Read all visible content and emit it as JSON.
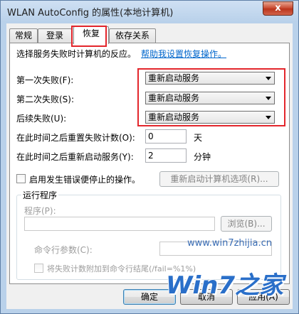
{
  "window": {
    "title": "WLAN AutoConfig 的属性(本地计算机)",
    "close_label": "x"
  },
  "tabs": [
    {
      "label": "常规"
    },
    {
      "label": "登录"
    },
    {
      "label": "恢复"
    },
    {
      "label": "依存关系"
    }
  ],
  "recovery": {
    "intro_text": "选择服务失败时计算机的反应。",
    "help_link": "帮助我设置恢复操作。",
    "first_failure_label": "第一次失败(F):",
    "first_failure_value": "重新启动服务",
    "second_failure_label": "第二次失败(S):",
    "second_failure_value": "重新启动服务",
    "subsequent_failure_label": "后续失败(U):",
    "subsequent_failure_value": "重新启动服务",
    "reset_count_label": "在此时间之后重置失败计数(O):",
    "reset_count_value": "0",
    "reset_count_unit": "天",
    "restart_after_label": "在此时间之后重新启动服务(Y):",
    "restart_after_value": "2",
    "restart_after_unit": "分钟",
    "enable_actions_label": "启用发生错误便停止的操作。",
    "restart_options_button": "重新启动计算机选项(R)..."
  },
  "run_program": {
    "group_label": "运行程序",
    "program_label": "程序(P):",
    "program_value": "",
    "browse_button": "浏览(B)...",
    "cmd_params_label": "命令行参数(C):",
    "cmd_params_value": "",
    "append_fail_count_label": "将失败计数附加到命令行结尾(/fail=%1%)"
  },
  "footer": {
    "ok_button": "确定",
    "cancel_button": "取消",
    "apply_button": "应用(A)"
  },
  "watermark": {
    "url": "www.win7zhijia.cn",
    "brand": "Win7之家"
  },
  "colors": {
    "highlight_box": "#e3262c",
    "link": "#0066cc",
    "watermark": "#2a6fc9"
  }
}
